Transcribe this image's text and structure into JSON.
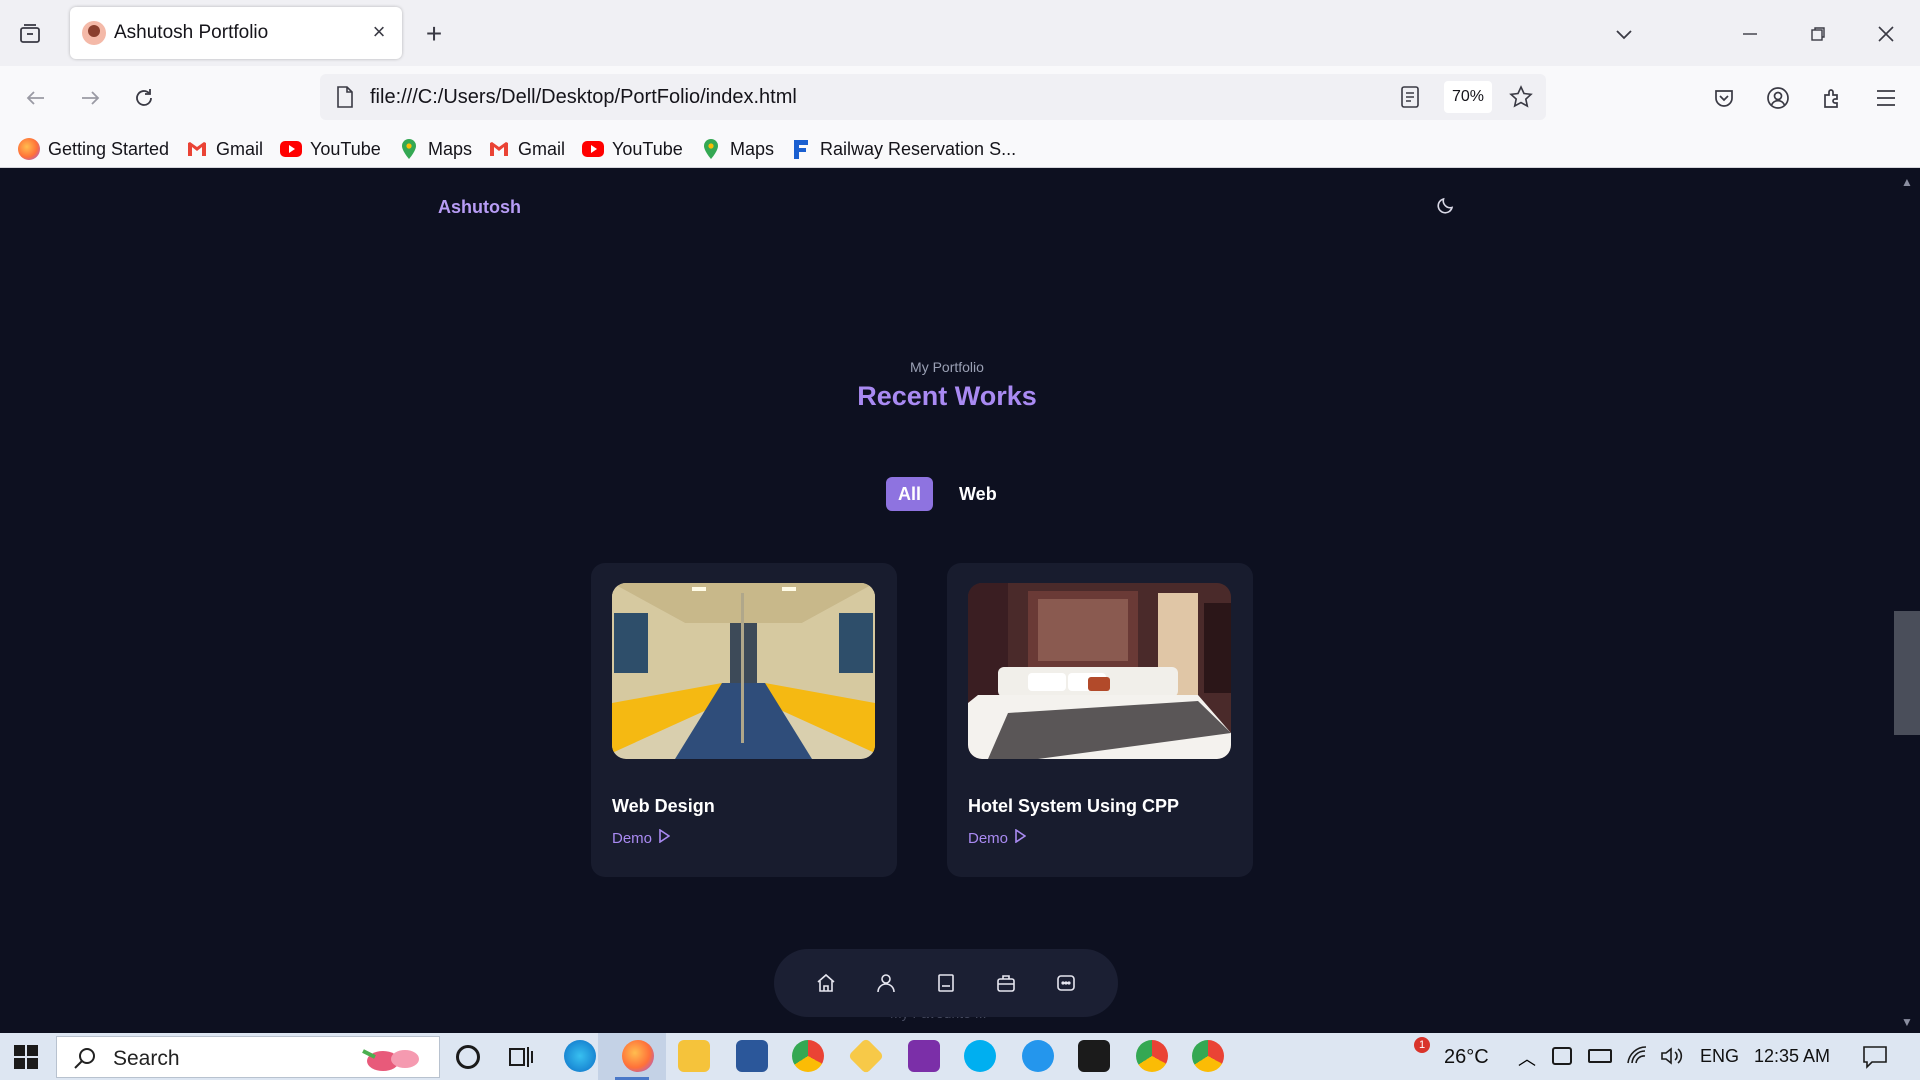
{
  "browser": {
    "tab_title": "Ashutosh Portfolio",
    "url": "file:///C:/Users/Dell/Desktop/PortFolio/index.html",
    "zoom": "70%"
  },
  "bookmarks": [
    {
      "label": "Getting Started",
      "icon": "firefox-icon",
      "color": "#ff7139"
    },
    {
      "label": "Gmail",
      "icon": "gmail-icon",
      "color": "#ea4335"
    },
    {
      "label": "YouTube",
      "icon": "youtube-icon",
      "color": "#ff0000"
    },
    {
      "label": "Maps",
      "icon": "maps-icon",
      "color": "#34a853"
    },
    {
      "label": "Gmail",
      "icon": "gmail-icon",
      "color": "#ea4335"
    },
    {
      "label": "YouTube",
      "icon": "youtube-icon",
      "color": "#ff0000"
    },
    {
      "label": "Maps",
      "icon": "maps-icon",
      "color": "#34a853"
    },
    {
      "label": "Railway Reservation S...",
      "icon": "railway-icon",
      "color": "#1a5fd0"
    }
  ],
  "page": {
    "brand": "Ashutosh",
    "subtitle": "My Portfolio",
    "title": "Recent Works",
    "filters": [
      "All",
      "Web"
    ],
    "projects": [
      {
        "title": "Web Design",
        "link": "Demo"
      },
      {
        "title": "Hotel System Using CPP",
        "link": "Demo"
      }
    ],
    "ghost_text": "My Favourite ..."
  },
  "colors": {
    "accent": "#a98af2",
    "page_bg": "#0d1020",
    "card_bg": "#181c2e"
  },
  "taskbar": {
    "search_label": "Search",
    "weather": "26°C",
    "language": "ENG",
    "time": "12:35 AM",
    "weather_badge": "1"
  }
}
